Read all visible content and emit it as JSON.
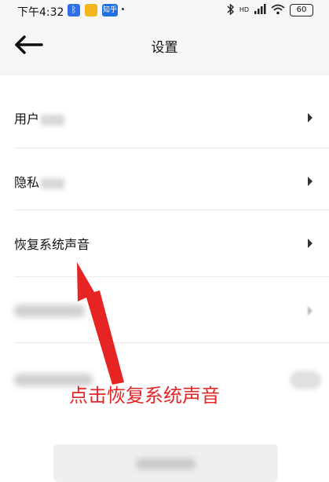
{
  "status_bar": {
    "time": "下午4:32",
    "app_icon_labels": {
      "zhihu": "知乎"
    },
    "signal_label": "HD",
    "battery": "60"
  },
  "header": {
    "title": "设置"
  },
  "rows": [
    {
      "label": "用户"
    },
    {
      "label": "隐私"
    },
    {
      "label": "恢复系统声音"
    }
  ],
  "annotation": {
    "text": "点击恢复系统声音",
    "color": "#e62424"
  },
  "colors": {
    "accent_annotation": "#e62424",
    "background": "#f4f4f6",
    "card": "#ffffff"
  }
}
